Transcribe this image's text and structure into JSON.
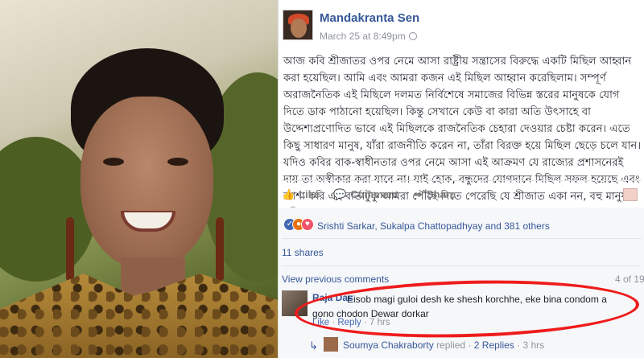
{
  "post": {
    "author": "Mandakranta Sen",
    "timestamp": "March 25 at 8:49pm",
    "body": "আজ কবি শ্রীজাতর ওপর নেমে আসা রাষ্ট্রীয় সন্ত্রাসের বিরুদ্ধে একটি মিছিল আহ্বান করা হয়েছিল। আমি এবং আমরা কজন এই মিছিল আহ্বান করেছিলাম। সম্পূর্ণ অরাজনৈতিক এই মিছিলে দলমত নির্বিশেষে সমাজের বিভিন্ন স্তরের মানুষকে যোগ দিতে ডাক পাঠানো হয়েছিল। কিন্তু সেখানে কেউ বা কারা অতি উৎসাহে বা উদ্দেশ্যপ্রণোদিত ভাবে এই মিছিলকে রাজনৈতিক চেহারা দেওয়ার চেষ্টা করেন। এতে কিছু সাধারণ মানুষ, যাঁরা রাজনীতি করেন না, তাঁরা বিরক্ত হয়ে মিছিল ছেড়ে চলে যান। যদিও কবির বাক-স্বাধীনতার ওপর নেমে আসা এই আক্রমণ যে রাজ্যের প্রশাসনেরই দায় তা অস্বীকার করা যাবে না। যাই হোক, বন্ধুদের যোগদানে মিছিল সফল হয়েছে এবং আশা করি এই বার্তাটুকু আমরা পৌঁছে দিতে পেরেছি যে শ্রীজাত একা নন, বহু মানুষ তাঁর পাশে আছেন।"
  },
  "actions": {
    "like": "Like",
    "comment": "Comment",
    "share": "Share"
  },
  "reactions": {
    "names": "Srishti Sarkar, Sukalpa Chattopadhyay and 381 others",
    "types": [
      "like-icon",
      "angry-icon",
      "love-icon"
    ]
  },
  "shares": "11 shares",
  "comments": {
    "view_previous": "View previous comments",
    "counter": "4 of 19",
    "items": [
      {
        "author": "Raja Das",
        "text": "Eisob magi guloi desh ke shesh korchhe, eke bina condom a gono chodon Dewar dorkar",
        "like": "Like",
        "reply": "Reply",
        "time": "7 hrs"
      }
    ],
    "reply_summary": {
      "author": "Soumya Chakraborty",
      "action": "replied",
      "count": "2 Replies",
      "time": "3 hrs"
    }
  },
  "colors": {
    "link": "#365899",
    "highlight": "#ee1c1c"
  }
}
